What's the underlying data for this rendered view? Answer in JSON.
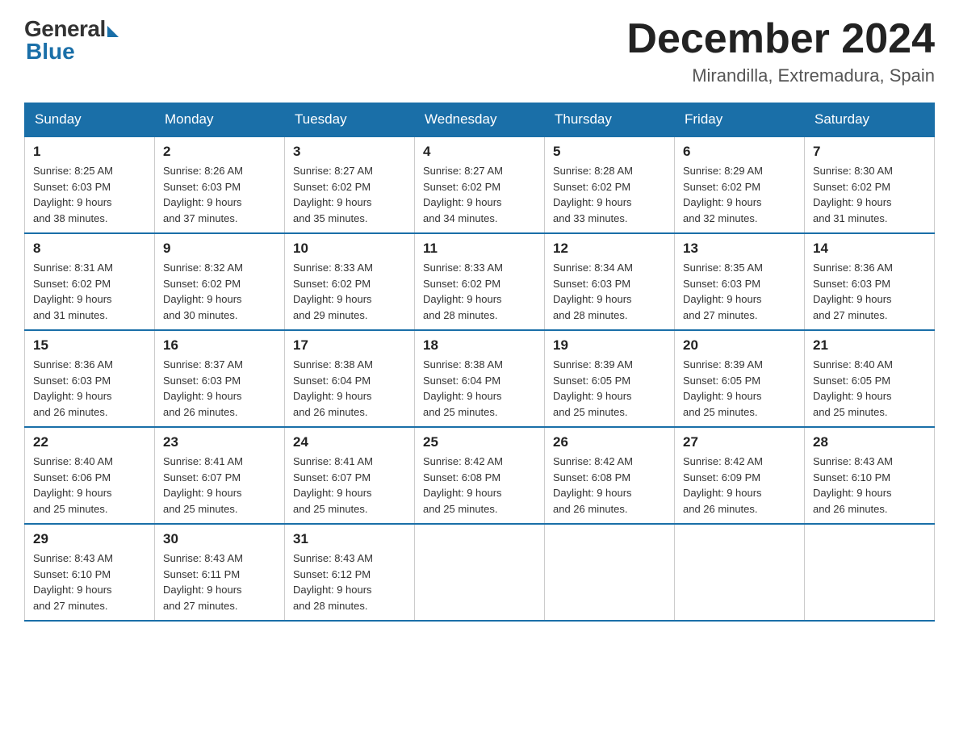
{
  "logo": {
    "general": "General",
    "blue": "Blue"
  },
  "title": {
    "month_year": "December 2024",
    "location": "Mirandilla, Extremadura, Spain"
  },
  "headers": [
    "Sunday",
    "Monday",
    "Tuesday",
    "Wednesday",
    "Thursday",
    "Friday",
    "Saturday"
  ],
  "weeks": [
    [
      {
        "day": "1",
        "sunrise": "8:25 AM",
        "sunset": "6:03 PM",
        "daylight": "9 hours and 38 minutes."
      },
      {
        "day": "2",
        "sunrise": "8:26 AM",
        "sunset": "6:03 PM",
        "daylight": "9 hours and 37 minutes."
      },
      {
        "day": "3",
        "sunrise": "8:27 AM",
        "sunset": "6:02 PM",
        "daylight": "9 hours and 35 minutes."
      },
      {
        "day": "4",
        "sunrise": "8:27 AM",
        "sunset": "6:02 PM",
        "daylight": "9 hours and 34 minutes."
      },
      {
        "day": "5",
        "sunrise": "8:28 AM",
        "sunset": "6:02 PM",
        "daylight": "9 hours and 33 minutes."
      },
      {
        "day": "6",
        "sunrise": "8:29 AM",
        "sunset": "6:02 PM",
        "daylight": "9 hours and 32 minutes."
      },
      {
        "day": "7",
        "sunrise": "8:30 AM",
        "sunset": "6:02 PM",
        "daylight": "9 hours and 31 minutes."
      }
    ],
    [
      {
        "day": "8",
        "sunrise": "8:31 AM",
        "sunset": "6:02 PM",
        "daylight": "9 hours and 31 minutes."
      },
      {
        "day": "9",
        "sunrise": "8:32 AM",
        "sunset": "6:02 PM",
        "daylight": "9 hours and 30 minutes."
      },
      {
        "day": "10",
        "sunrise": "8:33 AM",
        "sunset": "6:02 PM",
        "daylight": "9 hours and 29 minutes."
      },
      {
        "day": "11",
        "sunrise": "8:33 AM",
        "sunset": "6:02 PM",
        "daylight": "9 hours and 28 minutes."
      },
      {
        "day": "12",
        "sunrise": "8:34 AM",
        "sunset": "6:03 PM",
        "daylight": "9 hours and 28 minutes."
      },
      {
        "day": "13",
        "sunrise": "8:35 AM",
        "sunset": "6:03 PM",
        "daylight": "9 hours and 27 minutes."
      },
      {
        "day": "14",
        "sunrise": "8:36 AM",
        "sunset": "6:03 PM",
        "daylight": "9 hours and 27 minutes."
      }
    ],
    [
      {
        "day": "15",
        "sunrise": "8:36 AM",
        "sunset": "6:03 PM",
        "daylight": "9 hours and 26 minutes."
      },
      {
        "day": "16",
        "sunrise": "8:37 AM",
        "sunset": "6:03 PM",
        "daylight": "9 hours and 26 minutes."
      },
      {
        "day": "17",
        "sunrise": "8:38 AM",
        "sunset": "6:04 PM",
        "daylight": "9 hours and 26 minutes."
      },
      {
        "day": "18",
        "sunrise": "8:38 AM",
        "sunset": "6:04 PM",
        "daylight": "9 hours and 25 minutes."
      },
      {
        "day": "19",
        "sunrise": "8:39 AM",
        "sunset": "6:05 PM",
        "daylight": "9 hours and 25 minutes."
      },
      {
        "day": "20",
        "sunrise": "8:39 AM",
        "sunset": "6:05 PM",
        "daylight": "9 hours and 25 minutes."
      },
      {
        "day": "21",
        "sunrise": "8:40 AM",
        "sunset": "6:05 PM",
        "daylight": "9 hours and 25 minutes."
      }
    ],
    [
      {
        "day": "22",
        "sunrise": "8:40 AM",
        "sunset": "6:06 PM",
        "daylight": "9 hours and 25 minutes."
      },
      {
        "day": "23",
        "sunrise": "8:41 AM",
        "sunset": "6:07 PM",
        "daylight": "9 hours and 25 minutes."
      },
      {
        "day": "24",
        "sunrise": "8:41 AM",
        "sunset": "6:07 PM",
        "daylight": "9 hours and 25 minutes."
      },
      {
        "day": "25",
        "sunrise": "8:42 AM",
        "sunset": "6:08 PM",
        "daylight": "9 hours and 25 minutes."
      },
      {
        "day": "26",
        "sunrise": "8:42 AM",
        "sunset": "6:08 PM",
        "daylight": "9 hours and 26 minutes."
      },
      {
        "day": "27",
        "sunrise": "8:42 AM",
        "sunset": "6:09 PM",
        "daylight": "9 hours and 26 minutes."
      },
      {
        "day": "28",
        "sunrise": "8:43 AM",
        "sunset": "6:10 PM",
        "daylight": "9 hours and 26 minutes."
      }
    ],
    [
      {
        "day": "29",
        "sunrise": "8:43 AM",
        "sunset": "6:10 PM",
        "daylight": "9 hours and 27 minutes."
      },
      {
        "day": "30",
        "sunrise": "8:43 AM",
        "sunset": "6:11 PM",
        "daylight": "9 hours and 27 minutes."
      },
      {
        "day": "31",
        "sunrise": "8:43 AM",
        "sunset": "6:12 PM",
        "daylight": "9 hours and 28 minutes."
      },
      null,
      null,
      null,
      null
    ]
  ],
  "labels": {
    "sunrise": "Sunrise:",
    "sunset": "Sunset:",
    "daylight": "Daylight:"
  }
}
